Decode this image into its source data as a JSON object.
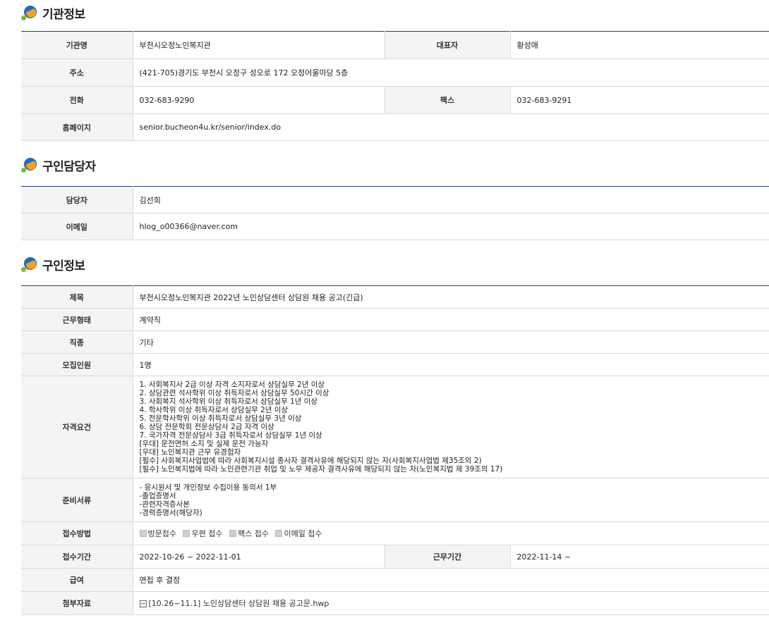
{
  "org": {
    "title": "기관정보",
    "name_label": "기관명",
    "name": "부천시오정노인복지관",
    "rep_label": "대표자",
    "rep": "황성애",
    "address_label": "주소",
    "address": "(421-705)경기도 부천시 오정구 성오로 172 오정어울마당 5층",
    "phone_label": "전화",
    "phone": "032-683-9290",
    "fax_label": "팩스",
    "fax": "032-683-9291",
    "homepage_label": "홈페이지",
    "homepage": "senior.bucheon4u.kr/senior/index.do"
  },
  "contact": {
    "title": "구인담당자",
    "person_label": "담당자",
    "person": "김선희",
    "email_label": "이메일",
    "email": "hlog_o00366@naver.com"
  },
  "job": {
    "title": "구인정보",
    "subject_label": "제목",
    "subject": "부천시오정노인복지관 2022년 노인상담센터 상담원 채용 공고(긴급)",
    "worktype_label": "근무형태",
    "worktype": "계약직",
    "category_label": "직종",
    "category": "기타",
    "count_label": "모집인원",
    "count": "1명",
    "req_label": "자격요건",
    "requirements": [
      "1. 사회복지사 2급 이상 자격 소지자로서 상담실무 2년 이상",
      "2. 상담관련 석사학위 이상 취득자로서 상담실무 50시간 이상",
      "3. 사회복지 석사학위 이상 취득자로서 상담실무 1년 이상",
      "4. 학사학위 이상 취득자로서 상담실무 2년 이상",
      "5. 전문학사학위 이상 취득자로서 상담실무 3년 이상",
      "6. 상담 전문학회 전문상담사 2급 자격 이상",
      "7. 국가자격 전문상담사 3급 취득자로서 상담실무 1년 이상",
      "[우대] 운전면허 소지 및 실제 운전 가능자",
      "[우대] 노인복지관 근무 유경험자",
      "[필수] 사회복지사업법에 따라 사회복지시설 종사자 결격사유에 해당되지 않는 자(사회복지사업법 제35조의 2)",
      "[필수] 노인복지법에 따라 노인관련기관 취업 및 노무 제공자 결격사유에 해당되지 않는 자(노인복지법 제 39조의 17)"
    ],
    "docs_label": "준비서류",
    "docs": [
      "- 응시원서 및 개인정보 수집이용 동의서 1부",
      "-졸업증명서",
      "-관련자격증사본",
      "-경력증명서(해당자)"
    ],
    "method_label": "접수방법",
    "methods": [
      "방문접수",
      "우편 접수",
      "팩스 접수",
      "이메일 접수"
    ],
    "period_label": "접수기간",
    "period": "2022-10-26 ~ 2022-11-01",
    "workperiod_label": "근무기간",
    "workperiod": "2022-11-14 ~",
    "salary_label": "급여",
    "salary": "면접 후 결정",
    "attach_label": "첨부자료",
    "attachment": "[10.26~11.1] 노인상담센터 상담원 채용 공고문.hwp"
  }
}
